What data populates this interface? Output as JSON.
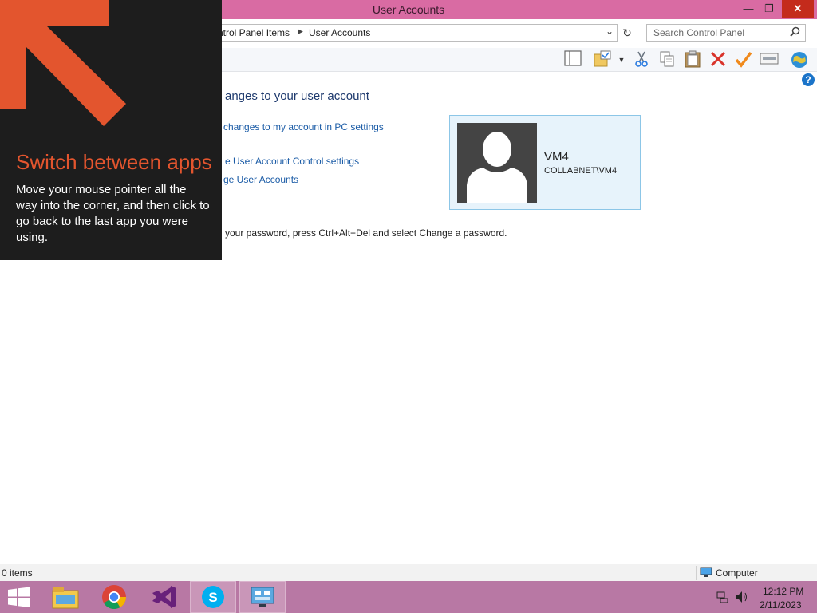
{
  "window": {
    "title": "User Accounts",
    "minimize_label": "—",
    "maximize_label": "❐",
    "close_label": "✕"
  },
  "address_bar": {
    "breadcrumbs": [
      "ntrol Panel Items",
      "User Accounts"
    ],
    "separator": "▶",
    "dropdown_glyph": "⌄",
    "refresh_glyph": "↻"
  },
  "search": {
    "placeholder": "Search Control Panel"
  },
  "toolbar": {
    "icons": [
      "layout-icon",
      "folder-properties-icon",
      "cut-icon",
      "copy-icon",
      "paste-icon",
      "delete-icon",
      "checkmark-icon",
      "properties-icon",
      "globe-icon"
    ]
  },
  "content": {
    "heading": "anges to your user account",
    "links": [
      "changes to my account in PC settings",
      "e User Account Control settings",
      "ge User Accounts"
    ],
    "info_text": "your password, press Ctrl+Alt+Del and select Change a password.",
    "help_label": "?"
  },
  "user_card": {
    "name": "VM4",
    "domain": "COLLABNET\\VM4"
  },
  "status_bar": {
    "items_count": "0 items",
    "location": "Computer"
  },
  "taskbar": {
    "apps": [
      "start-icon",
      "file-explorer-icon",
      "chrome-icon",
      "visual-studio-icon",
      "skype-icon",
      "control-panel-icon"
    ],
    "clock_time": "12:12 PM",
    "clock_date": "2/11/2023"
  },
  "hint_overlay": {
    "title": "Switch between apps",
    "body": "Move your mouse pointer all the way into the corner, and then click to go back to the last app you were using."
  },
  "colors": {
    "titlebar": "#d96ba3",
    "taskbar": "#b878a4",
    "overlay_bg": "#1d1d1d",
    "overlay_accent": "#e3552e",
    "link": "#1a5ba6",
    "card_bg": "#e7f3fb",
    "card_border": "#8cc6e7"
  }
}
